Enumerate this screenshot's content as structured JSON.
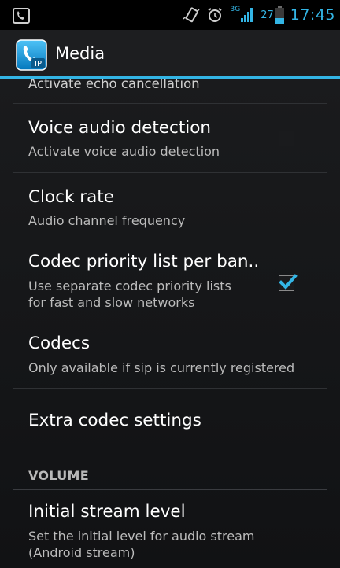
{
  "status_bar": {
    "time": "17:45",
    "battery_level": "27",
    "network": "3G",
    "icons": [
      "sip-notification-icon",
      "vibrate-icon",
      "alarm-icon",
      "signal-icon",
      "battery-icon"
    ]
  },
  "action_bar": {
    "title": "Media",
    "app_icon_label": "IP"
  },
  "partial_item": {
    "summary": "Activate echo cancellation"
  },
  "preferences": [
    {
      "title": "Voice audio detection",
      "summary": "Activate voice audio detection",
      "checkbox": false
    },
    {
      "title": "Clock rate",
      "summary": "Audio channel frequency"
    },
    {
      "title": "Codec priority list per ban..",
      "summary_lines": [
        "Use separate codec priority lists",
        "for fast and slow networks"
      ],
      "checkbox": true
    },
    {
      "title": "Codecs",
      "summary": "Only available if sip is currently registered"
    },
    {
      "title": "Extra codec settings"
    }
  ],
  "section": {
    "label": "VOLUME"
  },
  "volume_item": {
    "title": "Initial stream level",
    "summary_lines": [
      "Set the initial level for audio stream",
      "(Android stream)"
    ]
  },
  "colors": {
    "accent": "#33b5e5",
    "background": "#161719",
    "summary_text": "#bcbcbc"
  }
}
